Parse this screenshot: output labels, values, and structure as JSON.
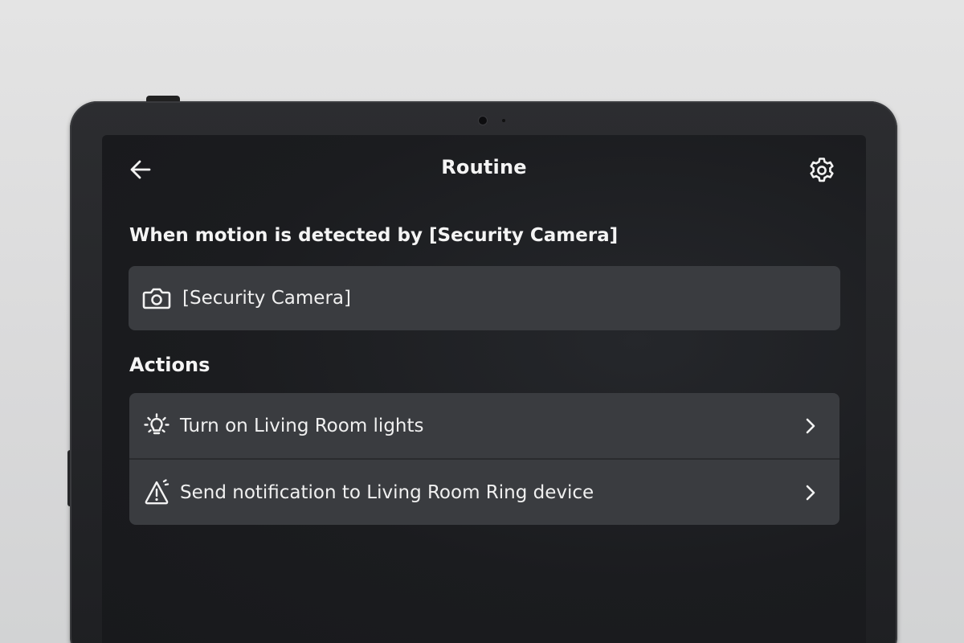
{
  "header": {
    "title": "Routine",
    "back_icon": "arrow-left-icon",
    "settings_icon": "gear-icon"
  },
  "trigger": {
    "heading": "When motion is detected by [Security Camera]",
    "device_label": "[Security Camera]",
    "device_icon": "camera-icon"
  },
  "actions": {
    "heading": "Actions",
    "items": [
      {
        "label": "Turn on Living Room lights",
        "icon": "lightbulb-icon"
      },
      {
        "label": "Send notification to Living Room Ring device",
        "icon": "alert-notification-icon"
      }
    ]
  },
  "colors": {
    "screen_background": "#1b1c1f",
    "card_background": "#3a3c40",
    "text": "#f2f2f2"
  }
}
